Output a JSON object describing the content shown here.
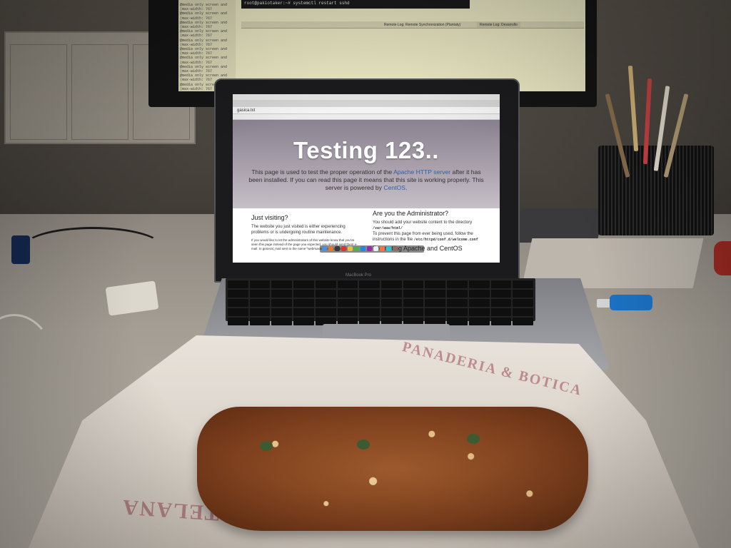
{
  "monitor": {
    "terminal_line": "root@pakiotaker:~# systemctl restart sshd",
    "css_rule": "@media only screen and (max-width: 767",
    "tabs": [
      "Remote Log: Remote Synchronization (Plantaty)",
      "Remote Log: Desarrollo"
    ]
  },
  "laptop": {
    "url": "gasica.txt",
    "hero": {
      "title": "Testing 123..",
      "text_before_link": "This page is used to test the proper operation of the ",
      "link_apache": "Apache HTTP server",
      "text_middle": " after it has been installed. If you can read this page it means that this site is working properly. This server is powered by ",
      "link_centos": "CentOS",
      "text_end": "."
    },
    "left_col": {
      "heading": "Just visiting?",
      "text": "The website you just visited is either experiencing problems or is undergoing routine maintenance.",
      "fine_print": "If you would like to let the administrators of this website know that you've seen this page instead of the page you expected, you should send them e-mail. In general, mail sent to the name \"webmaster\" and directed to the"
    },
    "right_col": {
      "heading": "Are you the Administrator?",
      "text": "You should add your website content to the directory",
      "path": "/var/www/html/",
      "text2": "To prevent this page from ever being used, follow the instructions in the file",
      "file": "/etc/httpd/conf.d/welcome.conf",
      "heading2": "Promoting Apache and CentOS"
    },
    "brand": "MacBook Pro"
  },
  "wrapper": {
    "print_top": "PANADERIA & BOTICA",
    "print_bottom": "HORTELANA"
  }
}
